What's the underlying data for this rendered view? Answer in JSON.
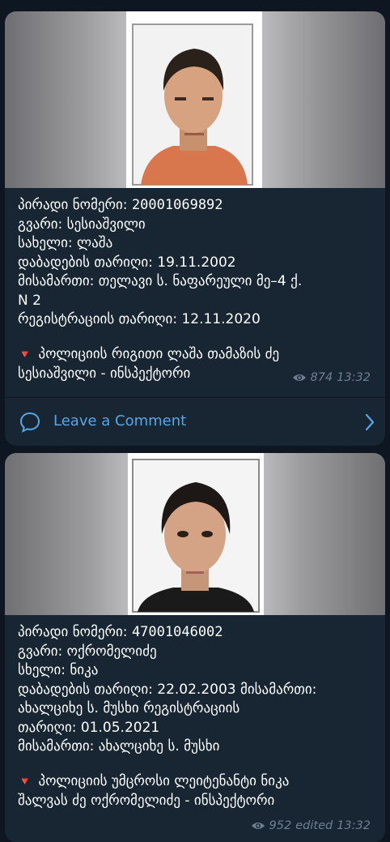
{
  "posts": [
    {
      "lines": {
        "id": "პირადი ნომერი: ",
        "id_value": "20001069892",
        "surname": "გვარი: სესიაშვილი",
        "name": "სახელი: ლაშა",
        "birth": "დაბადების თარიღი: 19.11.2002",
        "address1": "მისამართი: თელავი ს. ნაფარეული მე–4 ქ.",
        "address2": "N 2",
        "reg": "რეგისტრაციის თარიღი: 12.11.2020",
        "rank1": "პოლიციის რიგითი ლაშა თამაზის ძე",
        "rank2": "სესიაშვილი - ინსპექტორი"
      },
      "views": "874",
      "time": "13:32",
      "comment_label": "Leave a Comment"
    },
    {
      "lines": {
        "id": "პირადი ნომერი: ",
        "id_value": "47001046002",
        "surname": "გვარი: ოქრომელიძე",
        "name": "სხელი: ნიკა",
        "birth": "დაბადების თარიღი: 22.02.2003  მისამართი:",
        "address1": "ახალციხე ს. მუსხი     რეგისტრაციის",
        "address2": "თარიღი: 01.05.2021",
        "reg": "მისამართი: ახალციხე ს. მუსხი",
        "rank1": "პოლიციის უმცროსი ლეიტენანტი ნიკა",
        "rank2": "შალვას ძე ოქრომელიძე - ინსპექტორი"
      },
      "views": "952",
      "edited": "edited",
      "time": "13:32"
    }
  ],
  "icons": {
    "marker": "🔻",
    "views": "eye-icon",
    "comment": "comment-bubble-icon",
    "chevron": "chevron-right-icon"
  },
  "colors": {
    "background": "#0e1621",
    "bubble": "#182533",
    "accent": "#56a7e8",
    "meta": "#6d8094",
    "marker": "#e0301e"
  }
}
